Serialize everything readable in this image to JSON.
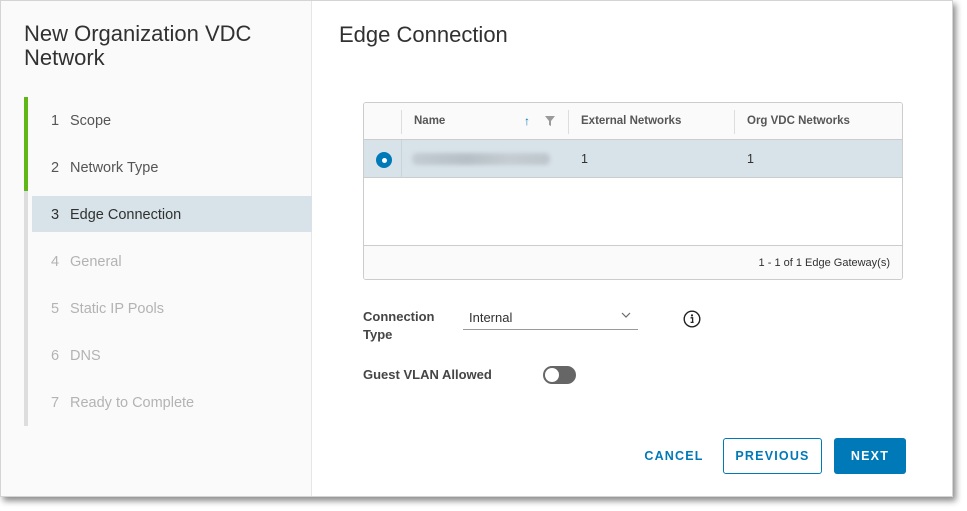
{
  "wizard": {
    "title": "New Organization VDC Network",
    "steps": [
      {
        "num": "1",
        "label": "Scope",
        "state": "done"
      },
      {
        "num": "2",
        "label": "Network Type",
        "state": "done"
      },
      {
        "num": "3",
        "label": "Edge Connection",
        "state": "current"
      },
      {
        "num": "4",
        "label": "General",
        "state": "todo"
      },
      {
        "num": "5",
        "label": "Static IP Pools",
        "state": "todo"
      },
      {
        "num": "6",
        "label": "DNS",
        "state": "todo"
      },
      {
        "num": "7",
        "label": "Ready to Complete",
        "state": "todo"
      }
    ]
  },
  "page": {
    "title": "Edge Connection"
  },
  "grid": {
    "columns": [
      "Name",
      "External Networks",
      "Org VDC Networks"
    ],
    "rows": [
      {
        "name": "",
        "external_networks": "1",
        "org_vdc_networks": "1",
        "selected": true
      }
    ],
    "footer": "1 - 1 of 1 Edge Gateway(s)"
  },
  "form": {
    "connection_type_label": "Connection Type",
    "connection_type_value": "Internal",
    "guest_vlan_label": "Guest VLAN Allowed",
    "guest_vlan_enabled": false
  },
  "buttons": {
    "cancel": "CANCEL",
    "previous": "PREVIOUS",
    "next": "NEXT"
  },
  "colors": {
    "accent": "#0079b8",
    "step_done": "#5eb715",
    "selected_row": "#d8e3e9"
  },
  "icons": [
    "sort-ascending-icon",
    "filter-icon",
    "chevron-down-icon",
    "info-icon"
  ]
}
